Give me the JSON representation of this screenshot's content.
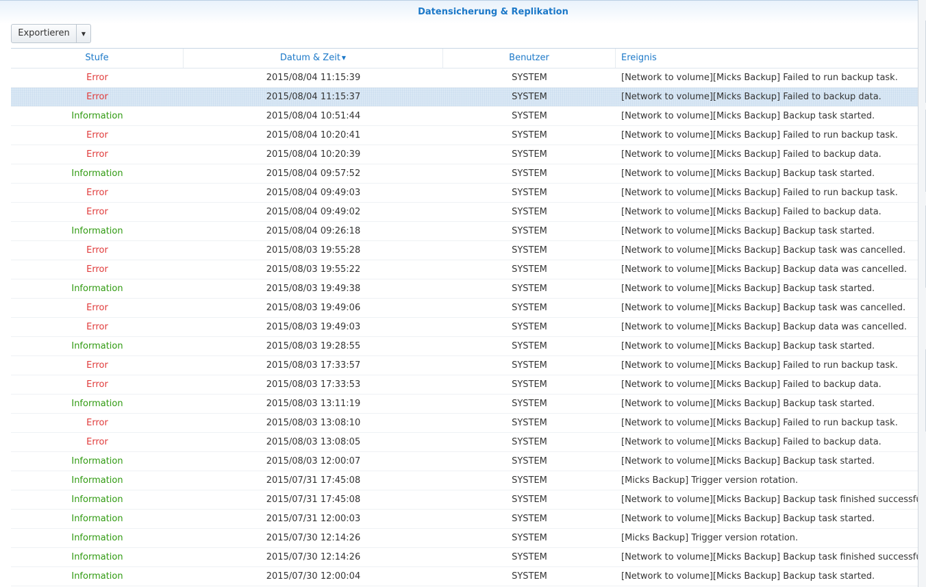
{
  "window": {
    "title": "Datensicherung & Replikation"
  },
  "toolbar": {
    "export_label": "Exportieren",
    "export_arrow_icon": "caret-down-icon"
  },
  "columns": {
    "level": "Stufe",
    "datetime": "Datum & Zeit",
    "user": "Benutzer",
    "event": "Ereignis"
  },
  "colors": {
    "accent": "#1b78c8",
    "error": "#e03a3a",
    "information": "#2f9a10",
    "selected_row": "#dbe9f5"
  },
  "selected_row_index": 1,
  "rows": [
    {
      "level": "Error",
      "datetime": "2015/08/04 11:15:39",
      "user": "SYSTEM",
      "event": "[Network to volume][Micks Backup] Failed to run backup task."
    },
    {
      "level": "Error",
      "datetime": "2015/08/04 11:15:37",
      "user": "SYSTEM",
      "event": "[Network to volume][Micks Backup] Failed to backup data."
    },
    {
      "level": "Information",
      "datetime": "2015/08/04 10:51:44",
      "user": "SYSTEM",
      "event": "[Network to volume][Micks Backup] Backup task started."
    },
    {
      "level": "Error",
      "datetime": "2015/08/04 10:20:41",
      "user": "SYSTEM",
      "event": "[Network to volume][Micks Backup] Failed to run backup task."
    },
    {
      "level": "Error",
      "datetime": "2015/08/04 10:20:39",
      "user": "SYSTEM",
      "event": "[Network to volume][Micks Backup] Failed to backup data."
    },
    {
      "level": "Information",
      "datetime": "2015/08/04 09:57:52",
      "user": "SYSTEM",
      "event": "[Network to volume][Micks Backup] Backup task started."
    },
    {
      "level": "Error",
      "datetime": "2015/08/04 09:49:03",
      "user": "SYSTEM",
      "event": "[Network to volume][Micks Backup] Failed to run backup task."
    },
    {
      "level": "Error",
      "datetime": "2015/08/04 09:49:02",
      "user": "SYSTEM",
      "event": "[Network to volume][Micks Backup] Failed to backup data."
    },
    {
      "level": "Information",
      "datetime": "2015/08/04 09:26:18",
      "user": "SYSTEM",
      "event": "[Network to volume][Micks Backup] Backup task started."
    },
    {
      "level": "Error",
      "datetime": "2015/08/03 19:55:28",
      "user": "SYSTEM",
      "event": "[Network to volume][Micks Backup] Backup task was cancelled."
    },
    {
      "level": "Error",
      "datetime": "2015/08/03 19:55:22",
      "user": "SYSTEM",
      "event": "[Network to volume][Micks Backup] Backup data was cancelled."
    },
    {
      "level": "Information",
      "datetime": "2015/08/03 19:49:38",
      "user": "SYSTEM",
      "event": "[Network to volume][Micks Backup] Backup task started."
    },
    {
      "level": "Error",
      "datetime": "2015/08/03 19:49:06",
      "user": "SYSTEM",
      "event": "[Network to volume][Micks Backup] Backup task was cancelled."
    },
    {
      "level": "Error",
      "datetime": "2015/08/03 19:49:03",
      "user": "SYSTEM",
      "event": "[Network to volume][Micks Backup] Backup data was cancelled."
    },
    {
      "level": "Information",
      "datetime": "2015/08/03 19:28:55",
      "user": "SYSTEM",
      "event": "[Network to volume][Micks Backup] Backup task started."
    },
    {
      "level": "Error",
      "datetime": "2015/08/03 17:33:57",
      "user": "SYSTEM",
      "event": "[Network to volume][Micks Backup] Failed to run backup task."
    },
    {
      "level": "Error",
      "datetime": "2015/08/03 17:33:53",
      "user": "SYSTEM",
      "event": "[Network to volume][Micks Backup] Failed to backup data."
    },
    {
      "level": "Information",
      "datetime": "2015/08/03 13:11:19",
      "user": "SYSTEM",
      "event": "[Network to volume][Micks Backup] Backup task started."
    },
    {
      "level": "Error",
      "datetime": "2015/08/03 13:08:10",
      "user": "SYSTEM",
      "event": "[Network to volume][Micks Backup] Failed to run backup task."
    },
    {
      "level": "Error",
      "datetime": "2015/08/03 13:08:05",
      "user": "SYSTEM",
      "event": "[Network to volume][Micks Backup] Failed to backup data."
    },
    {
      "level": "Information",
      "datetime": "2015/08/03 12:00:07",
      "user": "SYSTEM",
      "event": "[Network to volume][Micks Backup] Backup task started."
    },
    {
      "level": "Information",
      "datetime": "2015/07/31 17:45:08",
      "user": "SYSTEM",
      "event": "[Micks Backup] Trigger version rotation."
    },
    {
      "level": "Information",
      "datetime": "2015/07/31 17:45:08",
      "user": "SYSTEM",
      "event": "[Network to volume][Micks Backup] Backup task finished successfully."
    },
    {
      "level": "Information",
      "datetime": "2015/07/31 12:00:03",
      "user": "SYSTEM",
      "event": "[Network to volume][Micks Backup] Backup task started."
    },
    {
      "level": "Information",
      "datetime": "2015/07/30 12:14:26",
      "user": "SYSTEM",
      "event": "[Micks Backup] Trigger version rotation."
    },
    {
      "level": "Information",
      "datetime": "2015/07/30 12:14:26",
      "user": "SYSTEM",
      "event": "[Network to volume][Micks Backup] Backup task finished successfully."
    },
    {
      "level": "Information",
      "datetime": "2015/07/30 12:00:04",
      "user": "SYSTEM",
      "event": "[Network to volume][Micks Backup] Backup task started."
    }
  ]
}
